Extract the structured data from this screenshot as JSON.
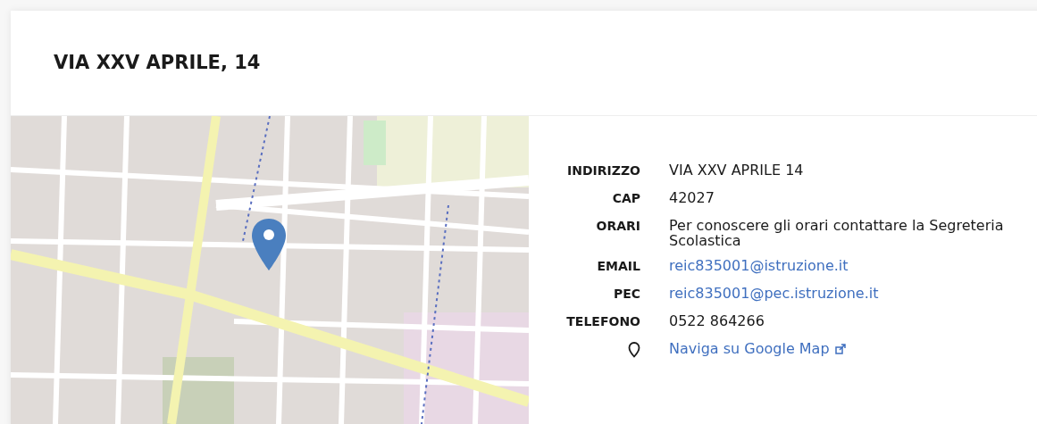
{
  "card": {
    "title": "VIA XXV APRILE, 14"
  },
  "details": [
    {
      "kind": "text",
      "label": "INDIRIZZO",
      "value": "VIA XXV APRILE 14"
    },
    {
      "kind": "text",
      "label": "CAP",
      "value": "42027"
    },
    {
      "kind": "text",
      "label": "ORARI",
      "value": "Per conoscere gli orari contattare la Segreteria Scolastica"
    },
    {
      "kind": "link",
      "label": "EMAIL",
      "value": "reic835001@istruzione.it"
    },
    {
      "kind": "link",
      "label": "PEC",
      "value": "reic835001@pec.istruzione.it"
    },
    {
      "kind": "text",
      "label": "TELEFONO",
      "value": "0522 864266"
    },
    {
      "kind": "map_link",
      "value": "Naviga su Google Map"
    }
  ]
}
